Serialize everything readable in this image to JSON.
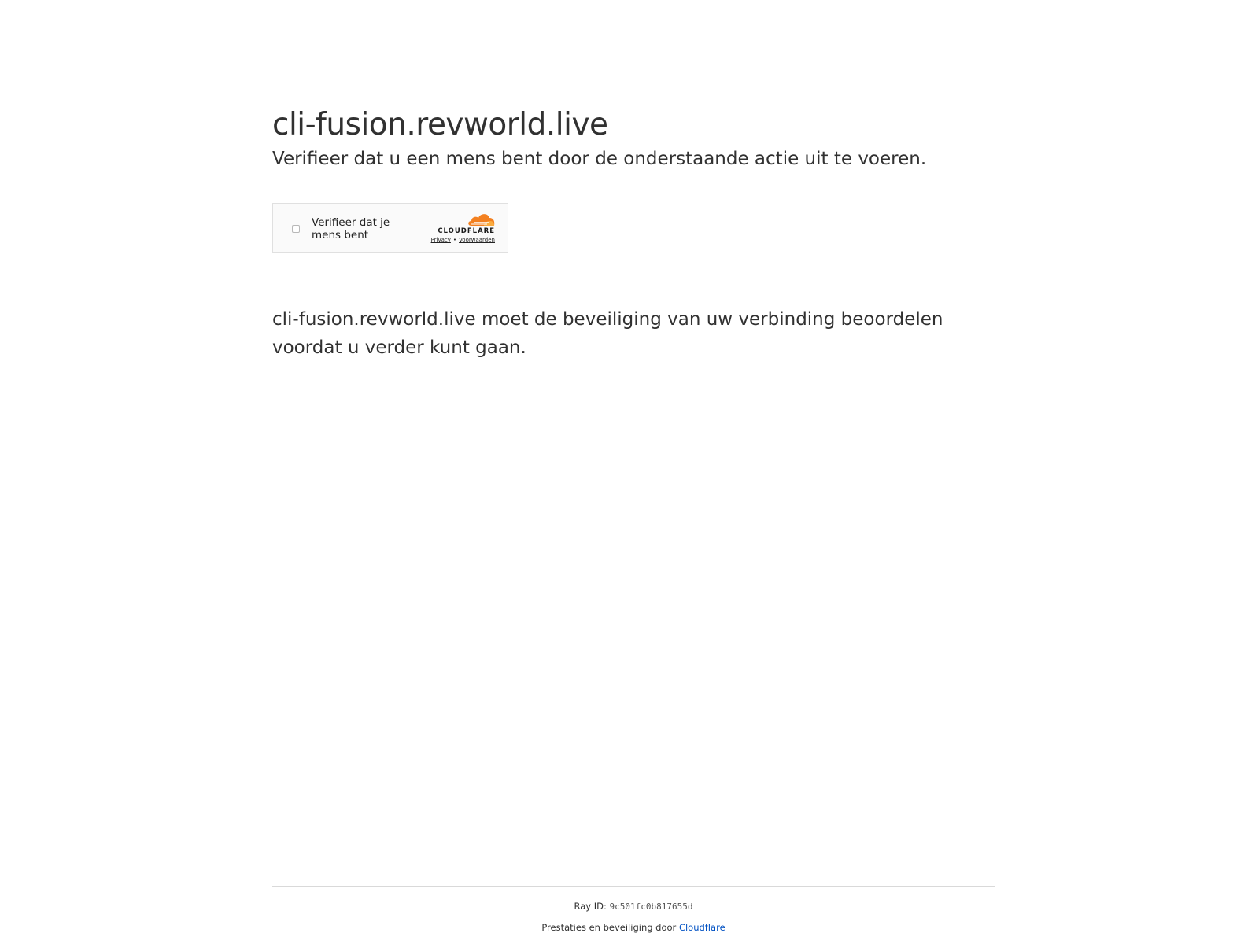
{
  "page": {
    "title": "cli-fusion.revworld.live",
    "subtitle": "Verifieer dat u een mens bent door de onderstaande actie uit te voeren.",
    "body": "cli-fusion.revworld.live moet de beveiliging van uw verbinding beoordelen voordat u verder kunt gaan."
  },
  "widget": {
    "label": "Verifieer dat je mens bent",
    "brand": "CLOUDFLARE",
    "privacy_link": "Privacy",
    "separator": "•",
    "terms_link": "Voorwaarden",
    "logo_icon": "cloudflare-cloud-icon",
    "logo_color": "#f38020"
  },
  "footer": {
    "ray_label": "Ray ID:",
    "ray_value": "9c501fc0b817655d",
    "performance_text": "Prestaties en beveiliging door",
    "performance_link": "Cloudflare",
    "link_color": "#0051c3"
  }
}
